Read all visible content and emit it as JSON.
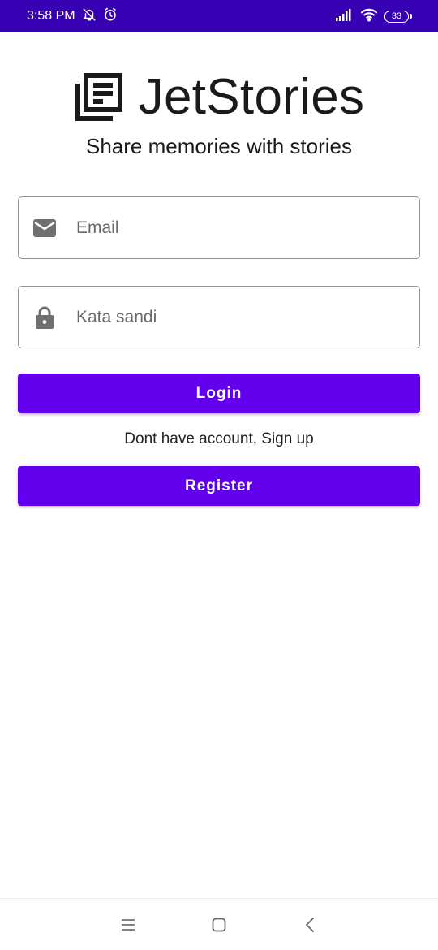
{
  "status_bar": {
    "time": "3:58 PM",
    "battery_level": "33",
    "icons": [
      "notifications-off-icon",
      "alarm-icon",
      "signal-icon",
      "wifi-icon",
      "battery-icon"
    ]
  },
  "app": {
    "title": "JetStories",
    "logo_icon": "newspaper-icon",
    "tagline": "Share memories with stories"
  },
  "form": {
    "email": {
      "placeholder": "Email",
      "value": "",
      "icon": "mail-icon"
    },
    "password": {
      "placeholder": "Kata sandi",
      "value": "",
      "icon": "lock-icon"
    },
    "login_label": "Login",
    "signup_prompt": "Dont have account, Sign up",
    "register_label": "Register"
  },
  "nav_bar": {
    "buttons": [
      "menu-icon",
      "home-icon",
      "back-icon"
    ]
  },
  "colors": {
    "status_bar": "#3700b3",
    "primary": "#6200ee",
    "text": "#1a1a1a",
    "field_border": "#8f8f8f",
    "icon_gray": "#6f6f6f"
  }
}
